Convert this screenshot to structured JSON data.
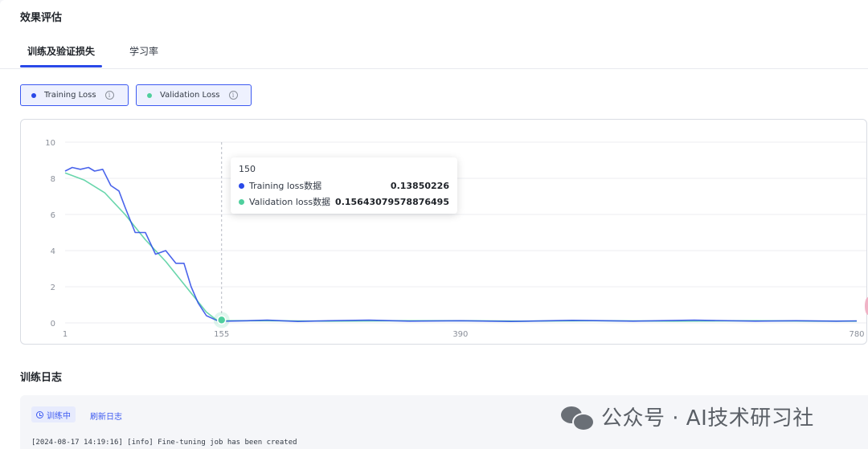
{
  "header": {
    "title": "效果评估"
  },
  "tabs": [
    {
      "label": "训练及验证损失",
      "active": true
    },
    {
      "label": "学习率",
      "active": false
    }
  ],
  "legend": [
    {
      "label": "Training Loss",
      "color": "#2a49e8",
      "info_glyph": "i"
    },
    {
      "label": "Validation Loss",
      "color": "#4fcf9d",
      "info_glyph": "i"
    }
  ],
  "tooltip": {
    "title": "150",
    "rows": [
      {
        "label": "Training loss数据",
        "value": "0.13850226",
        "color": "#2a49e8"
      },
      {
        "label": "Validation loss数据",
        "value": "0.15643079578876495",
        "color": "#4fcf9d"
      }
    ]
  },
  "chart_data": {
    "type": "line",
    "title": "",
    "xlabel": "",
    "ylabel": "",
    "ylim": [
      0,
      10
    ],
    "xlim": [
      1,
      780
    ],
    "yticks": [
      0,
      2,
      4,
      6,
      8,
      10
    ],
    "xticks": [
      "1",
      "155",
      "390",
      "780"
    ],
    "grid": true,
    "crosshair_x": 155,
    "series": [
      {
        "name": "Training Loss",
        "color": "#2a49e8",
        "x": [
          1,
          8,
          16,
          24,
          30,
          38,
          46,
          54,
          60,
          70,
          80,
          90,
          100,
          110,
          118,
          125,
          132,
          140,
          150,
          160,
          180,
          200,
          230,
          260,
          300,
          340,
          390,
          440,
          500,
          560,
          620,
          680,
          720,
          760,
          780
        ],
        "y": [
          8.4,
          8.6,
          8.5,
          8.6,
          8.4,
          8.5,
          7.6,
          7.3,
          6.4,
          5.0,
          5.0,
          3.8,
          4.0,
          3.3,
          3.3,
          2.0,
          1.1,
          0.4,
          0.14,
          0.1,
          0.12,
          0.15,
          0.08,
          0.12,
          0.15,
          0.1,
          0.12,
          0.08,
          0.14,
          0.1,
          0.15,
          0.1,
          0.12,
          0.1,
          0.11
        ]
      },
      {
        "name": "Validation Loss",
        "color": "#4fcf9d",
        "x": [
          1,
          20,
          40,
          60,
          80,
          100,
          120,
          140,
          150,
          160,
          200,
          260,
          330,
          390,
          450,
          520,
          600,
          680,
          740,
          780
        ],
        "y": [
          8.3,
          7.9,
          7.2,
          6.0,
          4.6,
          3.4,
          2.0,
          0.6,
          0.16,
          0.12,
          0.12,
          0.1,
          0.12,
          0.12,
          0.1,
          0.12,
          0.1,
          0.12,
          0.1,
          0.1
        ]
      }
    ]
  },
  "log": {
    "title": "训练日志",
    "status_label": "训练中",
    "refresh_label": "刷新日志",
    "first_line": "[2024-08-17 14:19:16] [info] Fine-tuning job has been created"
  },
  "watermark": {
    "text": "公众号 · AI技术研习社"
  }
}
